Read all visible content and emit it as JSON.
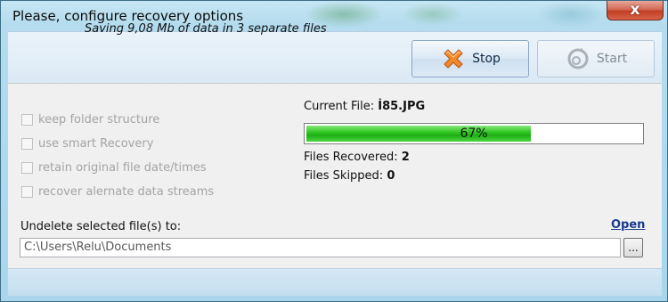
{
  "window": {
    "title": "Please, configure recovery options",
    "close_glyph": "x"
  },
  "header": {
    "saving_text": "Saving 9,08 Mb of data in 3 separate files",
    "stop_label": "Stop",
    "stop_icon": "stop-x-icon",
    "start_label": "Start",
    "start_icon": "start-recycle-icon"
  },
  "options": [
    {
      "label": "keep folder structure",
      "checked": false,
      "enabled": false
    },
    {
      "label": "use smart Recovery",
      "checked": false,
      "enabled": false
    },
    {
      "label": "retain original file date/times",
      "checked": false,
      "enabled": false
    },
    {
      "label": "recover alernate data streams",
      "checked": false,
      "enabled": false
    }
  ],
  "status": {
    "current_file_label": "Current File:",
    "current_file_value": "İ85.JPG",
    "progress_percent": 67,
    "progress_text": "67%",
    "files_recovered_label": "Files Recovered:",
    "files_recovered_value": "2",
    "files_skipped_label": "Files Skipped:",
    "files_skipped_value": "0"
  },
  "destination": {
    "label": "Undelete selected file(s) to:",
    "open_link": "Open",
    "path_value": "C:\\Users\\Relu\\Documents",
    "browse_label": "..."
  },
  "colors": {
    "progress_green": "#1ead14",
    "close_red": "#c13e23",
    "link_blue": "#1b3a8c",
    "disabled_text": "#a4a4a4"
  }
}
